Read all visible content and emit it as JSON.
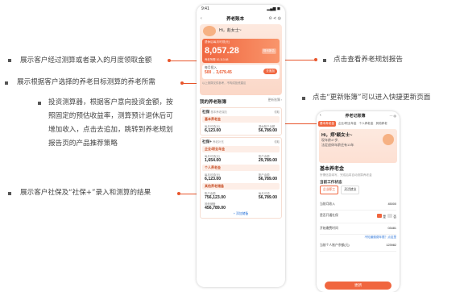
{
  "annotations": {
    "left_1": "展示客户经过测算或者录入的月度领取金额",
    "left_2": "展示根据客户选择的养老目标测算的养老所需",
    "left_3_l1": "投资测算器，根据客户意向投资金额，按",
    "left_3_l2": "照固定的预估收益率，测算预计退休后可",
    "left_3_l3": "增加收入，点击去追加，跳转到养老规划",
    "left_3_l4": "报告页的产品推荐策略",
    "left_4": "展示客户社保及“社保+”录入和测算的结果",
    "right_1": "点击查看养老规划报告",
    "right_2": "点击“更新账簿”可以进入快捷更新页面"
  },
  "phone1": {
    "time": "9:41",
    "signal": "▂▄▆ ◼",
    "title": "养老账本",
    "greeting": "Hi，赵女士~",
    "card_caption": "退休后每月可领(元)",
    "card_amount": "8,057.28",
    "card_tag": "规划报告",
    "card_sub": "养老所需 10,113.68",
    "calc_label": "每月投入",
    "calc_value": "500",
    "calc_value2": "3,679.45",
    "calc_button": "去追加",
    "tip": "以上测算仅供参考，不构成投资建议",
    "ledger_title": "我的养老账簿",
    "ledger_more": "更新账簿 ›",
    "social": {
      "title": "社保",
      "subtitle": "基本养老保险",
      "action": "领取",
      "pill": "基本养老金",
      "left_label": "每月可领(元)",
      "left_value": "6,123.00",
      "right_label": "退休账户余额",
      "right_value": "56,789.00"
    },
    "social_plus": {
      "title": "社保+",
      "subtitle": "养老补充",
      "action": "领取",
      "pill1": "企业/职业年金",
      "p1_left_label": "每月可领(元)",
      "p1_left_value": "1,654.00",
      "p1_right_label": "账户余额",
      "p1_right_value": "29,789.00",
      "pill2": "个人养老金",
      "p2_left_label": "每月可领(元)",
      "p2_left_value": "6,123.00",
      "p2_right_label": "账户余额",
      "p2_right_value": "56,789.00",
      "pill3": "其他养老储备",
      "p3_left_label": "账户余额",
      "p3_left_value": "756,123.00",
      "p3_right_label": "每月可领",
      "p3_right_value": "56,789.00",
      "p3_extra_label": "其他储备",
      "p3_extra_value": "456,789.00"
    },
    "footer_link": "+ 添加储备"
  },
  "phone2": {
    "title": "养老记账簿",
    "tabs": [
      "基本养老金",
      "企业/职业年金",
      "个人养老金",
      "其他养老"
    ],
    "greeting": "Hi，郑*颖女士~",
    "age": "现年龄47岁,",
    "retire_note": "法定退休年龄还有13年",
    "section": "基本养老金",
    "section_sub": "所需信息填写，完成后将自动测算养老金",
    "work_label": "当前工作状态",
    "opt1": "企业职工",
    "opt2": "灵活就业",
    "field1_label": "当前月收入",
    "field1_value": "45000",
    "field2_label": "是否开通社保",
    "field2_yes": "是",
    "field2_no": "否",
    "field3_label": "开始缴费时间",
    "field3_value": "03481",
    "link": "不知道缴费年限？点这里",
    "field4_label": "当前个人账户余额(元)",
    "field4_value": "123982",
    "submit": "更新"
  },
  "colors": {
    "accent": "#e8552b",
    "accent_light": "#fde9df"
  }
}
